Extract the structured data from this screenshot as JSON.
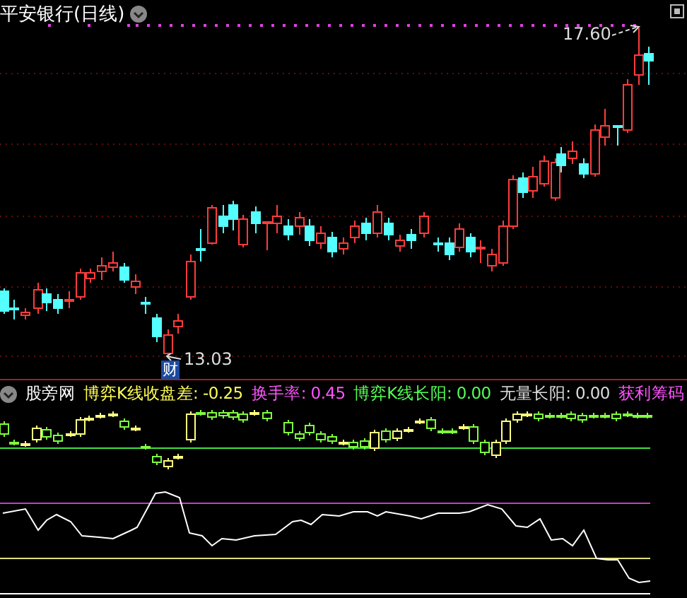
{
  "title": {
    "text": "平安银行(日线)"
  },
  "price_marks": [
    {
      "kind": "high",
      "value": "17.60"
    },
    {
      "kind": "low",
      "value": "13.03"
    }
  ],
  "event_tag": "财",
  "indicator": {
    "name": "股旁网",
    "readings": [
      {
        "label": "博弈K线收盘差:",
        "value": "-0.25",
        "color": "#ffff54"
      },
      {
        "label": "换手率:",
        "value": "0.45",
        "color": "#ff54ff"
      },
      {
        "label": "博弈K线长阳:",
        "value": "0.00",
        "color": "#54ff54"
      },
      {
        "label": "无量长阳:",
        "value": "0.00",
        "color": "#dddddd"
      },
      {
        "label": "获利筹码",
        "color": "#ff54ff"
      }
    ]
  }
}
